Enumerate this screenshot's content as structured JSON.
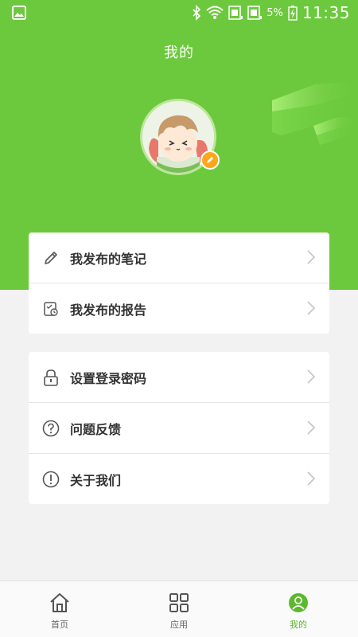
{
  "status_bar": {
    "battery_percent": "5%",
    "time": "11:35",
    "icons": [
      "gallery-icon",
      "bluetooth-icon",
      "wifi-icon",
      "sim1-icon",
      "sim2-icon",
      "battery-charging-icon"
    ]
  },
  "header": {
    "title": "我的",
    "accent_color": "#6cc93d"
  },
  "profile": {
    "avatar": "avatar-image",
    "edit_badge_color": "#ffa61a"
  },
  "menu_group_1": [
    {
      "icon": "pencil-icon",
      "label": "我发布的笔记"
    },
    {
      "icon": "report-icon",
      "label": "我发布的报告"
    }
  ],
  "menu_group_2": [
    {
      "icon": "lock-icon",
      "label": "设置登录密码"
    },
    {
      "icon": "question-icon",
      "label": "问题反馈"
    },
    {
      "icon": "info-icon",
      "label": "关于我们"
    }
  ],
  "tab_bar": {
    "items": [
      {
        "icon": "home-icon",
        "label": "首页",
        "active": false
      },
      {
        "icon": "grid-icon",
        "label": "应用",
        "active": false
      },
      {
        "icon": "user-icon",
        "label": "我的",
        "active": true
      }
    ],
    "active_color": "#5cb82e"
  }
}
